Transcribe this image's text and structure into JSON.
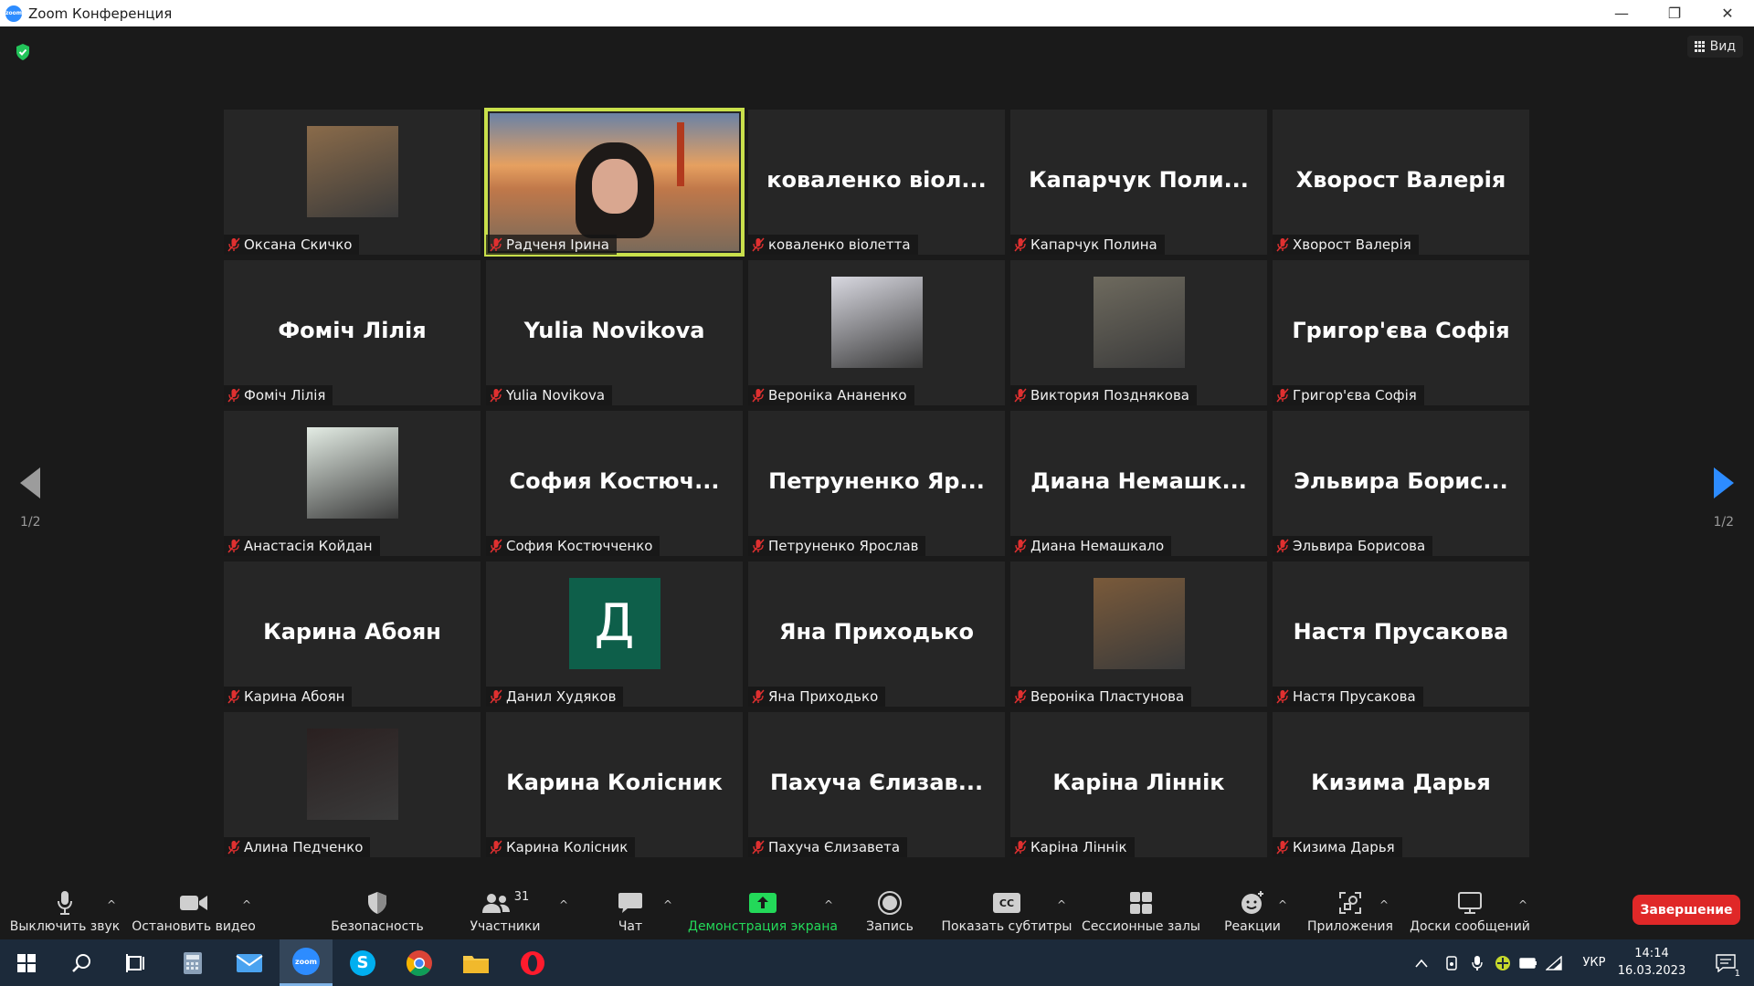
{
  "window": {
    "title": "Zoom Конференция",
    "logo_text": "zoom",
    "minimize": "—",
    "restore": "❐",
    "close": "✕"
  },
  "meeting": {
    "view_label": "Вид",
    "page_left": "1/2",
    "page_right": "1/2",
    "tiles": [
      {
        "name": "Оксана Скичко",
        "big": "",
        "type": "photo",
        "color": "#8a6b4a"
      },
      {
        "name": "Радченя Ірина",
        "big": "",
        "type": "video",
        "color": "#c0784a"
      },
      {
        "name": "коваленко віолетта",
        "big": "коваленко віол...",
        "type": "text"
      },
      {
        "name": "Капарчук Полина",
        "big": "Капарчук Поли...",
        "type": "text"
      },
      {
        "name": "Хворост Валерія",
        "big": "Хворост Валерія",
        "type": "text"
      },
      {
        "name": "Фоміч Лілія",
        "big": "Фоміч Лілія",
        "type": "text"
      },
      {
        "name": "Yulia Novikova",
        "big": "Yulia Novikova",
        "type": "text"
      },
      {
        "name": "Вероніка Ананенко",
        "big": "",
        "type": "photo",
        "color": "#d8d8e0"
      },
      {
        "name": "Виктория Позднякова",
        "big": "",
        "type": "photo",
        "color": "#6e6a5e"
      },
      {
        "name": "Григор'єва Софія",
        "big": "Григор'єва Софія",
        "type": "text"
      },
      {
        "name": "Анастасія Койдан",
        "big": "",
        "type": "photo",
        "color": "#e3ece4"
      },
      {
        "name": "София Костючченко",
        "big": "София Костюч...",
        "type": "text"
      },
      {
        "name": "Петруненко Ярослав",
        "big": "Петруненко Яр...",
        "type": "text"
      },
      {
        "name": "Диана Немашкало",
        "big": "Диана Немашк...",
        "type": "text"
      },
      {
        "name": "Эльвира Борисова",
        "big": "Эльвира Борис...",
        "type": "text"
      },
      {
        "name": "Карина Абоян",
        "big": "Карина Абоян",
        "type": "text"
      },
      {
        "name": "Данил Худяков",
        "big": "Д",
        "type": "letter"
      },
      {
        "name": "Яна Приходько",
        "big": "Яна Приходько",
        "type": "text"
      },
      {
        "name": "Вероніка Пластунова",
        "big": "",
        "type": "photo",
        "color": "#7a5a3a"
      },
      {
        "name": "Настя Прусакова",
        "big": "Настя Прусакова",
        "type": "text"
      },
      {
        "name": "Алина Педченко",
        "big": "",
        "type": "photo",
        "color": "#2a2020"
      },
      {
        "name": "Карина Колісник",
        "big": "Карина Колісник",
        "type": "text"
      },
      {
        "name": "Пахуча Єлизавета",
        "big": "Пахуча Єлизав...",
        "type": "text"
      },
      {
        "name": "Каріна Ліннік",
        "big": "Каріна Ліннік",
        "type": "text"
      },
      {
        "name": "Кизима Дарья",
        "big": "Кизима Дарья",
        "type": "text"
      }
    ]
  },
  "toolbar": {
    "mute": "Выключить звук",
    "video": "Остановить видео",
    "security": "Безопасность",
    "participants": "Участники",
    "participants_count": "31",
    "chat": "Чат",
    "share": "Демонстрация экрана",
    "record": "Запись",
    "captions": "Показать субтитры",
    "captions_icon_text": "CC",
    "breakout": "Сессионные залы",
    "reactions": "Реакции",
    "apps": "Приложения",
    "whiteboards": "Доски сообщений",
    "end": "Завершение",
    "caret": "^"
  },
  "taskbar": {
    "lang": "УКР",
    "time": "14:14",
    "date": "16.03.2023",
    "zoom_text": "zoom",
    "notif_count": "1"
  },
  "colors": {
    "accent_blue": "#2d8cff",
    "active_speaker": "#c9e04b",
    "share_green": "#23d959",
    "end_red": "#e02828",
    "muted_red": "#e03030"
  }
}
